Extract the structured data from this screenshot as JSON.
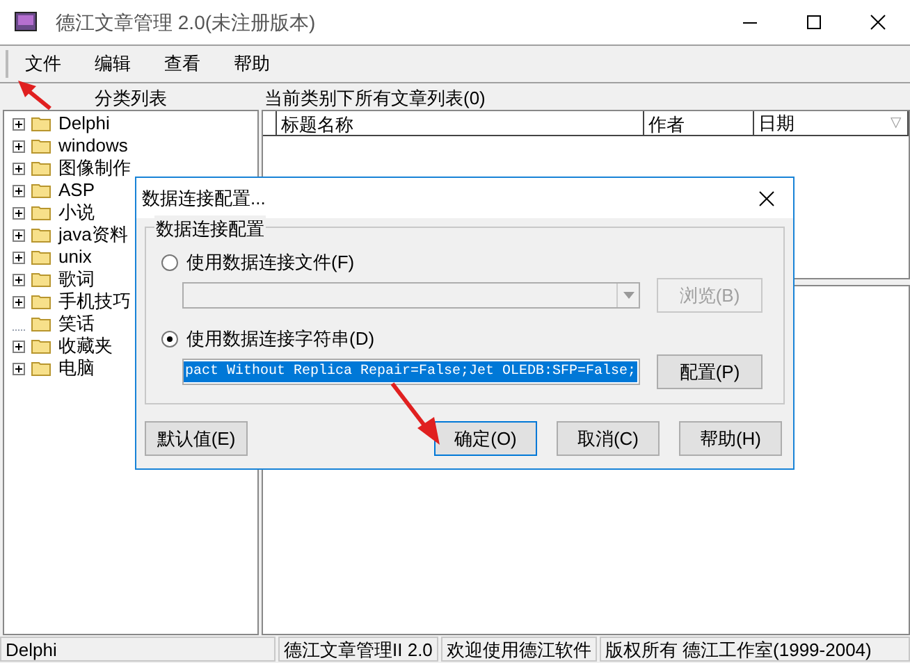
{
  "window": {
    "title": "德江文章管理 2.0(未注册版本)"
  },
  "menu": [
    "文件",
    "编辑",
    "查看",
    "帮助"
  ],
  "category_panel": {
    "title": "分类列表",
    "items": [
      {
        "label": "Delphi",
        "expandable": true
      },
      {
        "label": "windows",
        "expandable": true
      },
      {
        "label": "图像制作",
        "expandable": true
      },
      {
        "label": "ASP",
        "expandable": true
      },
      {
        "label": "小说",
        "expandable": true
      },
      {
        "label": "java资料",
        "expandable": true
      },
      {
        "label": "unix",
        "expandable": true
      },
      {
        "label": "歌词",
        "expandable": true
      },
      {
        "label": "手机技巧",
        "expandable": true
      },
      {
        "label": "笑话",
        "expandable": false
      },
      {
        "label": "收藏夹",
        "expandable": true
      },
      {
        "label": "电脑",
        "expandable": true
      }
    ]
  },
  "article_panel": {
    "title": "当前类别下所有文章列表(0)",
    "columns": [
      "标题名称",
      "作者",
      "日期"
    ],
    "sort_indicator": "▽"
  },
  "dialog": {
    "title": "数据连接配置...",
    "group_title": "数据连接配置",
    "options": [
      {
        "label": "使用数据连接文件(F)",
        "selected": false,
        "kind": "combo",
        "button": {
          "label": "浏览(B)",
          "disabled": true
        }
      },
      {
        "label": "使用数据连接字符串(D)",
        "selected": true,
        "kind": "text",
        "value": "pact Without Replica Repair=False;Jet OLEDB:SFP=False;",
        "button": {
          "label": "配置(P)",
          "disabled": false
        }
      }
    ],
    "buttons": [
      {
        "label": "默认值(E)",
        "kind": "left"
      },
      {
        "label": "确定(O)",
        "kind": "default"
      },
      {
        "label": "取消(C)",
        "kind": "normal"
      },
      {
        "label": "帮助(H)",
        "kind": "normal"
      }
    ]
  },
  "status_bar": [
    "Delphi",
    "德江文章管理II 2.0",
    "欢迎使用德江软件",
    "版权所有 德江工作室(1999-2004)"
  ]
}
